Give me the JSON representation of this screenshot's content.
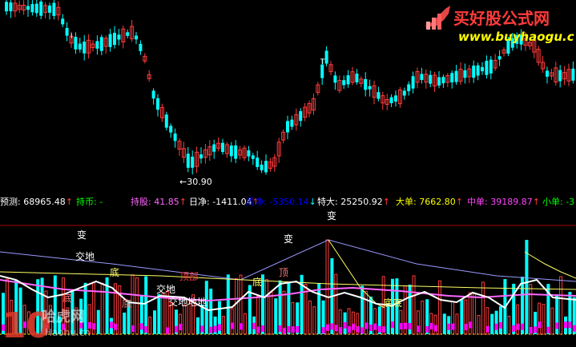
{
  "watermark_top": {
    "title": "买好股公式网",
    "url": "www.buyhaogu.com"
  },
  "watermark_bottom": {
    "digits": "10",
    "brand": "哈虎网",
    "url": "Haohu.cn"
  },
  "price_chart": {
    "low_marker": "←30.90",
    "marker_T": "T",
    "marker_I": "I"
  },
  "indicator_bar": {
    "items": [
      {
        "label": "预测: 68965.48",
        "arrow": "↑",
        "color": "#ffffff"
      },
      {
        "label": "持币: -",
        "arrow": "",
        "color": "#00ff00"
      },
      {
        "label": "持股: 41.85",
        "arrow": "↑",
        "color": "#ff66ff"
      },
      {
        "label": "日净: -1411.04",
        "arrow": "↑",
        "color": "#ffffff"
      },
      {
        "label": "周净: -5350.14",
        "arrow": "↓",
        "color": "#0000ff"
      },
      {
        "label": "特大: 25250.92",
        "arrow": "↑",
        "color": "#ffffff"
      },
      {
        "label": "大单: 7662.80",
        "arrow": "↑",
        "color": "#ffff00"
      },
      {
        "label": "中单: 39189.87",
        "arrow": "↑",
        "color": "#ff44ff"
      },
      {
        "label": "小单: -3",
        "arrow": "",
        "color": "#00ff00"
      }
    ]
  },
  "lower_labels": [
    "变",
    "变",
    "变",
    "交地",
    "底",
    "顶部",
    "交地",
    "交地地地",
    "底",
    "顶",
    "底",
    "底底",
    "底"
  ],
  "colors": {
    "up": "#ff3b3b",
    "down": "#00ffff",
    "magenta": "#ff00ff",
    "yellow": "#ffff00",
    "white": "#ffffff"
  }
}
